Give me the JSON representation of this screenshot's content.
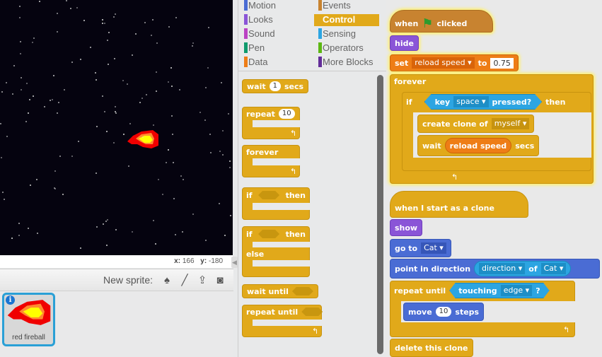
{
  "stage": {
    "coords": {
      "x_label": "x:",
      "x_value": "166",
      "y_label": "y:",
      "y_value": "-180"
    },
    "sprite_on_stage": "red fireball"
  },
  "sprite_pane": {
    "new_sprite_label": "New sprite:",
    "icons": [
      "sprite-library-icon",
      "paint-brush-icon",
      "upload-icon",
      "camera-icon"
    ],
    "sprites": [
      {
        "name": "red fireball",
        "selected": true,
        "info_badge": "i"
      }
    ]
  },
  "palette": {
    "categories": [
      {
        "label": "Motion",
        "color": "#4a6cd4"
      },
      {
        "label": "Looks",
        "color": "#8a55d7"
      },
      {
        "label": "Sound",
        "color": "#bb42c3"
      },
      {
        "label": "Pen",
        "color": "#0e9a6c"
      },
      {
        "label": "Data",
        "color": "#ee7d16"
      },
      {
        "label": "Events",
        "color": "#c88330"
      },
      {
        "label": "Control",
        "color": "#e1a91a",
        "selected": true
      },
      {
        "label": "Sensing",
        "color": "#2ca5e2"
      },
      {
        "label": "Operators",
        "color": "#5cb712"
      },
      {
        "label": "More Blocks",
        "color": "#632d99"
      }
    ],
    "blocks": {
      "wait": {
        "pre": "wait",
        "value": "1",
        "post": "secs"
      },
      "repeat": {
        "pre": "repeat",
        "value": "10"
      },
      "forever": "forever",
      "if_then": {
        "pre": "if",
        "post": "then"
      },
      "if_else": {
        "pre": "if",
        "post": "then",
        "else": "else"
      },
      "wait_until": "wait until",
      "repeat_until": "repeat until"
    }
  },
  "scripts": {
    "script1": {
      "hat": {
        "pre": "when",
        "post": "clicked"
      },
      "hide": "hide",
      "set": {
        "pre": "set",
        "var": "reload speed",
        "mid": "to",
        "value": "0.75"
      },
      "forever": "forever",
      "if": {
        "pre": "if",
        "key_pre": "key",
        "key": "space",
        "key_post": "pressed?",
        "post": "then"
      },
      "create_clone": {
        "label": "create clone of",
        "target": "myself"
      },
      "wait": {
        "pre": "wait",
        "var": "reload speed",
        "post": "secs"
      }
    },
    "script2": {
      "hat": "when I start as a clone",
      "show": "show",
      "goto": {
        "pre": "go to",
        "target": "Cat"
      },
      "point": {
        "pre": "point in direction",
        "attr": "direction",
        "of": "of",
        "obj": "Cat"
      },
      "repeat_until": {
        "pre": "repeat until",
        "sense": "touching",
        "obj": "edge",
        "q": "?"
      },
      "move": {
        "pre": "move",
        "value": "10",
        "post": "steps"
      },
      "delete": "delete this clone"
    }
  }
}
